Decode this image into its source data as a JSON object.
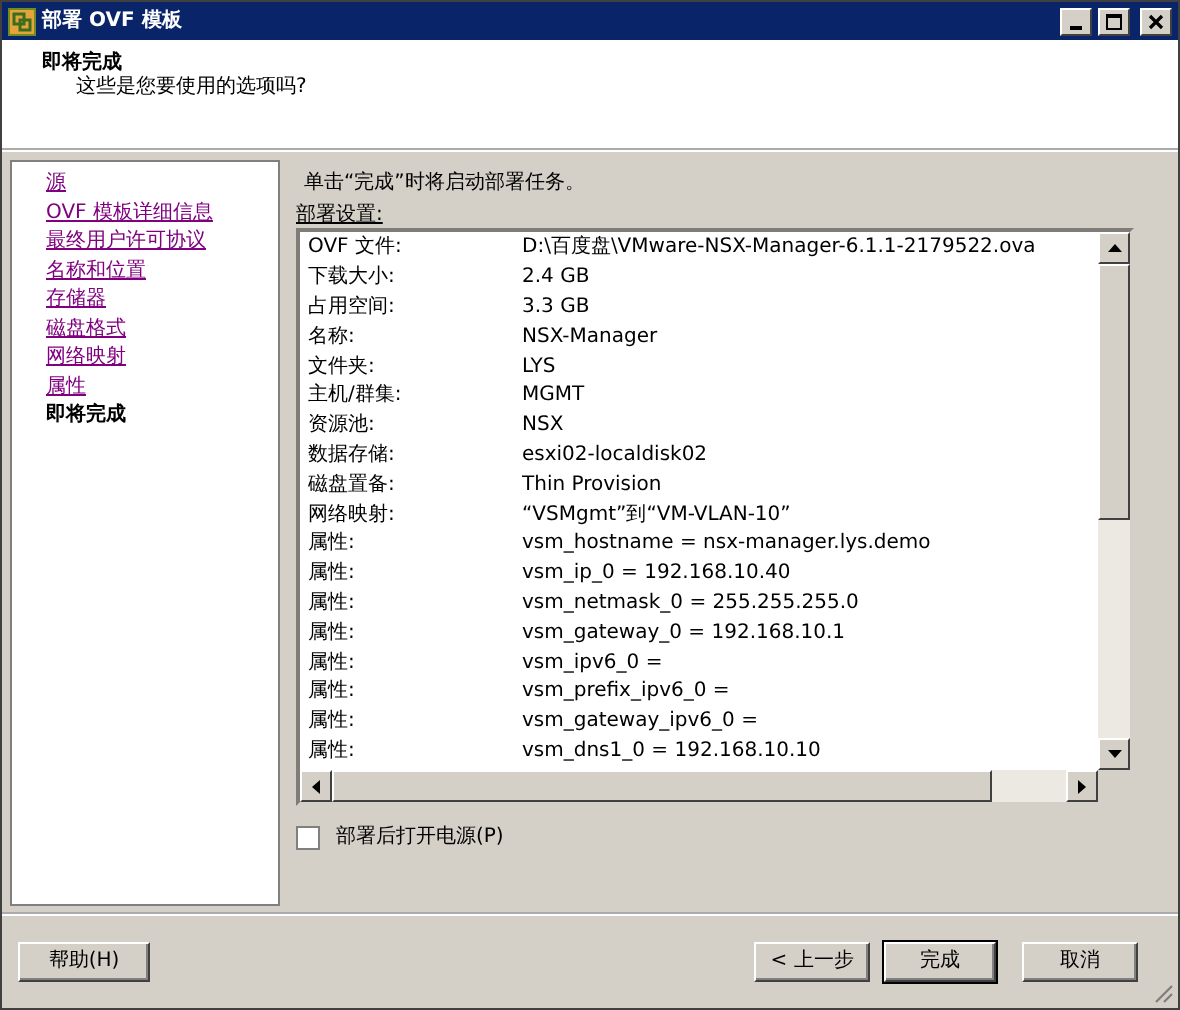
{
  "window": {
    "title": "部署 OVF 模板"
  },
  "header": {
    "title": "即将完成",
    "subtitle": "这些是您要使用的选项吗?"
  },
  "sidebar": {
    "items": [
      {
        "label": "源",
        "selected": false
      },
      {
        "label": "OVF 模板详细信息",
        "selected": false
      },
      {
        "label": "最终用户许可协议",
        "selected": false
      },
      {
        "label": "名称和位置",
        "selected": false
      },
      {
        "label": "存储器",
        "selected": false
      },
      {
        "label": "磁盘格式",
        "selected": false
      },
      {
        "label": "网络映射",
        "selected": false
      },
      {
        "label": "属性",
        "selected": false
      },
      {
        "label": "即将完成",
        "selected": true
      }
    ]
  },
  "instruction": "单击“完成”时将启动部署任务。",
  "settings": {
    "label": "部署设置:",
    "rows": [
      {
        "name": "OVF 文件:",
        "value": "D:\\百度盘\\VMware-NSX-Manager-6.1.1-2179522.ova"
      },
      {
        "name": "下载大小:",
        "value": "2.4 GB"
      },
      {
        "name": "占用空间:",
        "value": "3.3 GB"
      },
      {
        "name": "名称:",
        "value": "NSX-Manager"
      },
      {
        "name": "文件夹:",
        "value": "LYS"
      },
      {
        "name": "主机/群集:",
        "value": "MGMT"
      },
      {
        "name": "资源池:",
        "value": "NSX"
      },
      {
        "name": "数据存储:",
        "value": "esxi02-localdisk02"
      },
      {
        "name": "磁盘置备:",
        "value": "Thin Provision"
      },
      {
        "name": "网络映射:",
        "value": "“VSMgmt”到“VM-VLAN-10”"
      },
      {
        "name": "属性:",
        "value": "vsm_hostname = nsx-manager.lys.demo"
      },
      {
        "name": "属性:",
        "value": "vsm_ip_0 = 192.168.10.40"
      },
      {
        "name": "属性:",
        "value": "vsm_netmask_0 = 255.255.255.0"
      },
      {
        "name": "属性:",
        "value": "vsm_gateway_0 = 192.168.10.1"
      },
      {
        "name": "属性:",
        "value": "vsm_ipv6_0 ="
      },
      {
        "name": "属性:",
        "value": "vsm_prefix_ipv6_0 ="
      },
      {
        "name": "属性:",
        "value": "vsm_gateway_ipv6_0 ="
      },
      {
        "name": "属性:",
        "value": "vsm_dns1_0 = 192.168.10.10"
      }
    ]
  },
  "power_on": {
    "label": "部署后打开电源(P)",
    "checked": false
  },
  "buttons": {
    "help": "帮助(H)",
    "back": "< 上一步",
    "finish": "完成",
    "cancel": "取消"
  }
}
